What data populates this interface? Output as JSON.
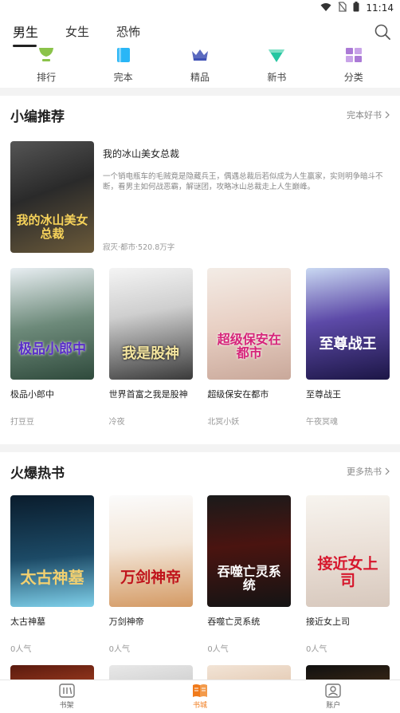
{
  "status": {
    "time": "11:14"
  },
  "tabs": [
    {
      "label": "男生",
      "active": true
    },
    {
      "label": "女生",
      "active": false
    },
    {
      "label": "恐怖",
      "active": false
    }
  ],
  "categories": [
    {
      "label": "排行",
      "icon": "trophy-icon",
      "color": "#8bc34a"
    },
    {
      "label": "完本",
      "icon": "book-icon",
      "color": "#29b6f6"
    },
    {
      "label": "精品",
      "icon": "crown-icon",
      "color": "#5c6bc0"
    },
    {
      "label": "新书",
      "icon": "diamond-icon",
      "color": "#26c6a1"
    },
    {
      "label": "分类",
      "icon": "grid-icon",
      "color": "#ab7ad6"
    }
  ],
  "recommend": {
    "title": "小编推荐",
    "more": "完本好书",
    "featured": {
      "title": "我的冰山美女总裁",
      "desc": "一个销电瓶车的毛贼竟是隐藏兵王，偶遇总裁后若似成为人生赢家，实则明争暗斗不断，看男主如何战恶霸，解谜团，攻略冰山总裁走上人生巅峰。",
      "meta": "寂灭·都市·520.8万字",
      "cover_text": "我的冰山美女总裁"
    },
    "books": [
      {
        "title": "极品小郎中",
        "author": "打豆豆",
        "cover_text": "极品小郎中"
      },
      {
        "title": "世界首富之我是股神",
        "author": "冷夜",
        "cover_text": "我是股神"
      },
      {
        "title": "超级保安在都市",
        "author": "北冥小妖",
        "cover_text": "超级保安在都市"
      },
      {
        "title": "至尊战王",
        "author": "午夜冥魂",
        "cover_text": "至尊战王"
      }
    ]
  },
  "hot": {
    "title": "火爆热书",
    "more": "更多热书",
    "books": [
      {
        "title": "太古神墓",
        "author": "0人气",
        "cover_text": "太古神墓"
      },
      {
        "title": "万剑神帝",
        "author": "0人气",
        "cover_text": "万剑神帝"
      },
      {
        "title": "吞噬亡灵系统",
        "author": "0人气",
        "cover_text": "吞噬亡灵系统"
      },
      {
        "title": "接近女上司",
        "author": "0人气",
        "cover_text": "接近女上司"
      }
    ]
  },
  "bottom_nav": [
    {
      "label": "书架",
      "active": false
    },
    {
      "label": "书城",
      "active": true
    },
    {
      "label": "账户",
      "active": false
    }
  ]
}
